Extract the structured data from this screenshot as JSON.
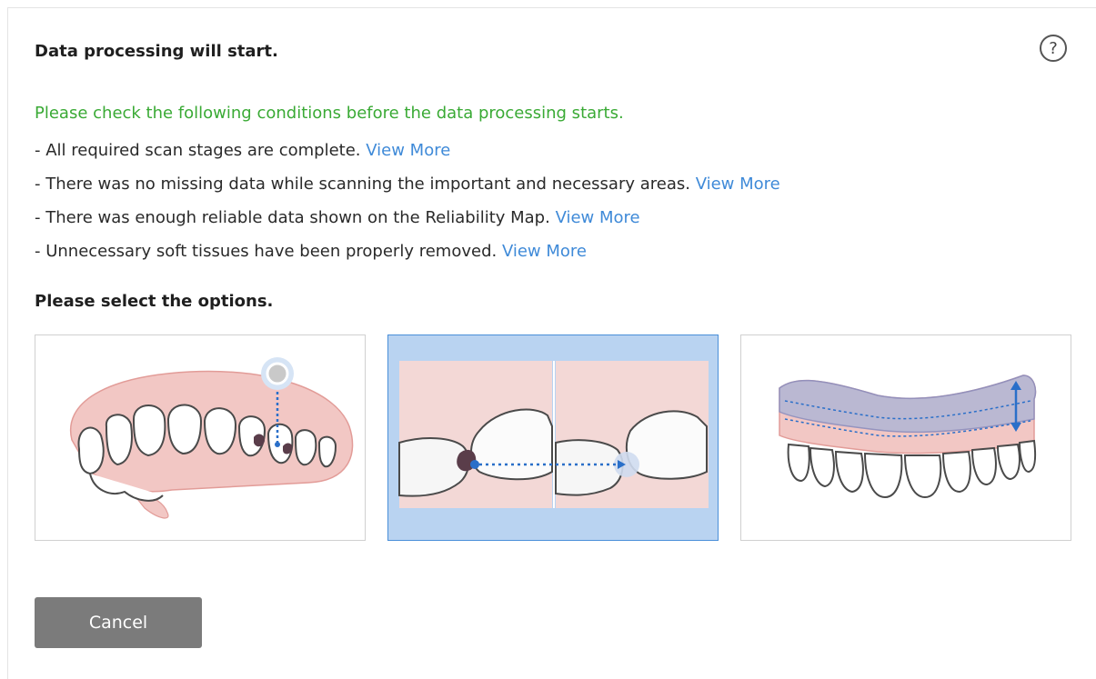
{
  "dialog": {
    "title": "Data processing will start.",
    "help_symbol": "?",
    "intro": "Please check the following conditions before the data processing starts.",
    "conditions": [
      {
        "text": "- All required scan stages are complete. ",
        "link": "View More"
      },
      {
        "text": "- There was no missing data while scanning the important and necessary areas. ",
        "link": "View More"
      },
      {
        "text": "- There was enough reliable data shown on the Reliability Map. ",
        "link": "View More"
      },
      {
        "text": "- Unnecessary soft tissues have been properly removed. ",
        "link": "View More"
      }
    ],
    "options_title": "Please select the options.",
    "options": [
      {
        "icon": "fill-holes-icon",
        "selected": false
      },
      {
        "icon": "fill-gaps-icon",
        "selected": true
      },
      {
        "icon": "trim-gingiva-height-icon",
        "selected": false
      }
    ],
    "cancel_label": "Cancel"
  },
  "colors": {
    "intro_text": "#3aaa35",
    "link": "#3f8ad8",
    "selected_bg": "#b9d3f1",
    "selected_border": "#4a8fd9",
    "cancel_bg": "#7b7b7b"
  }
}
